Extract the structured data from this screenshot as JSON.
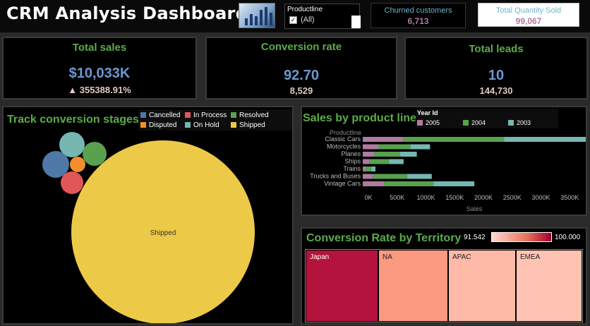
{
  "header": {
    "title": "CRM  Analysis Dashboard",
    "filter": {
      "label": "Productline",
      "value": "(All)"
    },
    "churned": {
      "label": "Churned customers",
      "value": "6,713"
    },
    "quantity": {
      "label": "Total Quantity Sold",
      "value": "99,067"
    }
  },
  "kpis": {
    "total_sales": {
      "title": "Total sales",
      "value": "$10,033K",
      "sub": "▲ 355388.91%"
    },
    "conversion_rate": {
      "title": "Conversion rate",
      "value": "92.70",
      "sub": "8,529"
    },
    "total_leads": {
      "title": "Total leads",
      "value": "10",
      "sub": "144,730"
    }
  },
  "stages": {
    "title": "Track conversion stages",
    "legend": [
      {
        "label": "Cancelled",
        "color": "#4e79a7"
      },
      {
        "label": "In Process",
        "color": "#e15759"
      },
      {
        "label": "Resolved",
        "color": "#59a14f"
      },
      {
        "label": "Disputed",
        "color": "#f28e2b"
      },
      {
        "label": "On Hold",
        "color": "#76b7b2"
      },
      {
        "label": "Shipped",
        "color": "#edc948"
      }
    ],
    "shipped_label": "Shipped"
  },
  "colors": {
    "accent_green": "#5cab4a",
    "value_blue": "#6d97cf",
    "y2005": "#b07aa1",
    "y2004": "#59a14f",
    "y2003": "#76b7b2"
  },
  "chart_data": [
    {
      "type": "bar",
      "title": "Sales by product line",
      "xlabel": "Sales",
      "ylabel": "Productline",
      "legend_title": "Year Id",
      "categories": [
        "Classic Cars",
        "Motorcycles",
        "Planes",
        "Ships",
        "Trains",
        "Trucks and Buses",
        "Vintage Cars"
      ],
      "series": [
        {
          "name": "2005",
          "values": [
            700000,
            270000,
            200000,
            120000,
            50000,
            180000,
            370000
          ]
        },
        {
          "name": "2004",
          "values": [
            1760000,
            560000,
            450000,
            340000,
            100000,
            590000,
            860000
          ]
        },
        {
          "name": "2003",
          "values": [
            1480000,
            340000,
            290000,
            250000,
            70000,
            430000,
            710000
          ]
        }
      ],
      "xticks": [
        "0K",
        "500K",
        "1000K",
        "1500K",
        "2000K",
        "2500K",
        "3000K",
        "3500K"
      ],
      "xlim": [
        0,
        4000000
      ],
      "stacked": true
    },
    {
      "type": "heatmap",
      "title": "Conversion Rate by Territory",
      "scale_min": "91.542",
      "scale_max": "100.000",
      "cells": [
        {
          "label": "Japan",
          "value": 100.0
        },
        {
          "label": "NA",
          "value": 95.0
        },
        {
          "label": "APAC",
          "value": 92.5
        },
        {
          "label": "EMEA",
          "value": 91.542
        }
      ]
    }
  ]
}
